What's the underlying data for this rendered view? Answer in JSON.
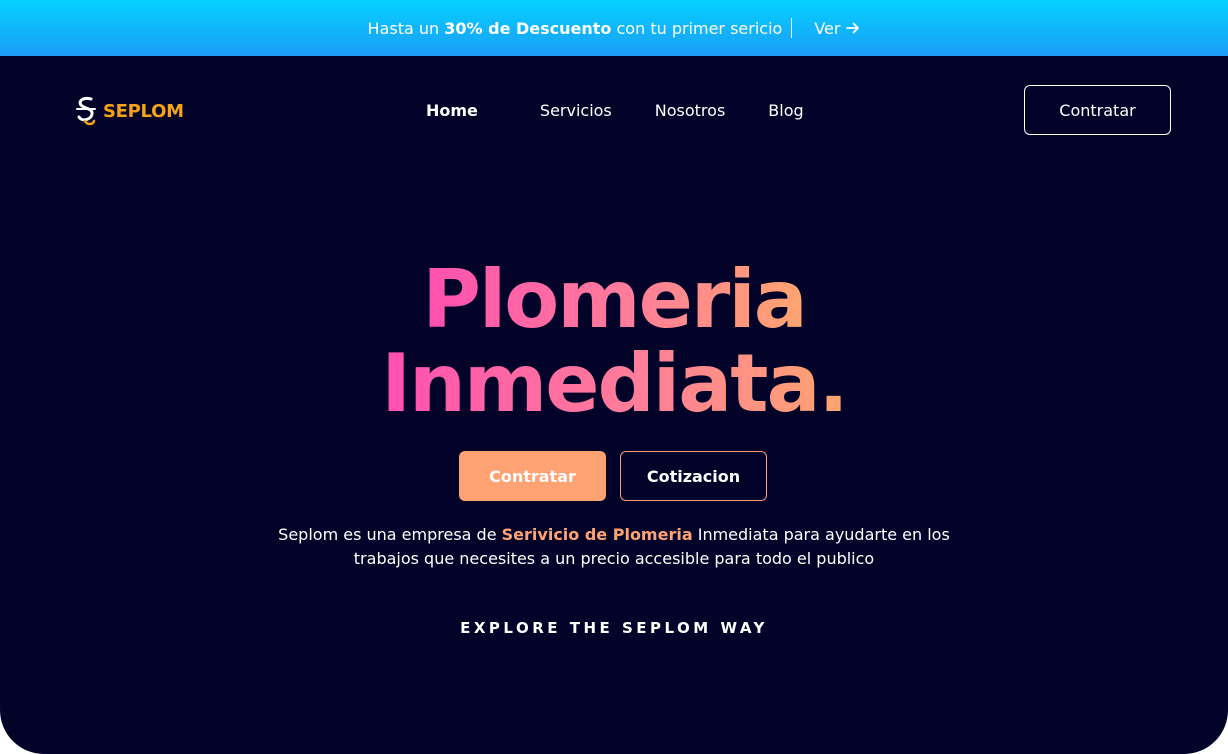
{
  "promo": {
    "text_prefix": "Hasta un",
    "highlight": "30% de Descuento",
    "text_suffix": "con tu primer sericio",
    "link_label": "Ver",
    "arrow_icon": "arrow-right-icon"
  },
  "nav": {
    "brand": "SEPLOM",
    "logo_icon": "seplom-logo-icon",
    "items": [
      {
        "label": "Home",
        "active": true
      },
      {
        "label": "Servicios",
        "active": false
      },
      {
        "label": "Nosotros",
        "active": false
      },
      {
        "label": "Blog",
        "active": false
      }
    ],
    "cta_label": "Contratar"
  },
  "hero": {
    "title_line1": "Plomeria",
    "title_line2": "Inmediata.",
    "primary_button": "Contratar",
    "secondary_button": "Cotizacion",
    "desc_prefix": "Seplom es una empresa de",
    "desc_highlight": "Serivicio de Plomeria",
    "desc_suffix_line1": "Inmediata para ayudarte en los",
    "desc_line2": "trabajos que necesites a un precio accesible para todo el publico",
    "explore_label": "EXPLORE THE SEPLOM WAY"
  },
  "colors": {
    "background": "#03032a",
    "accent_orange": "#ffa374",
    "gradient_pink": "#ff4fb0",
    "promo_blue": "#04d2ff",
    "brand_gold": "#f5a31a"
  }
}
